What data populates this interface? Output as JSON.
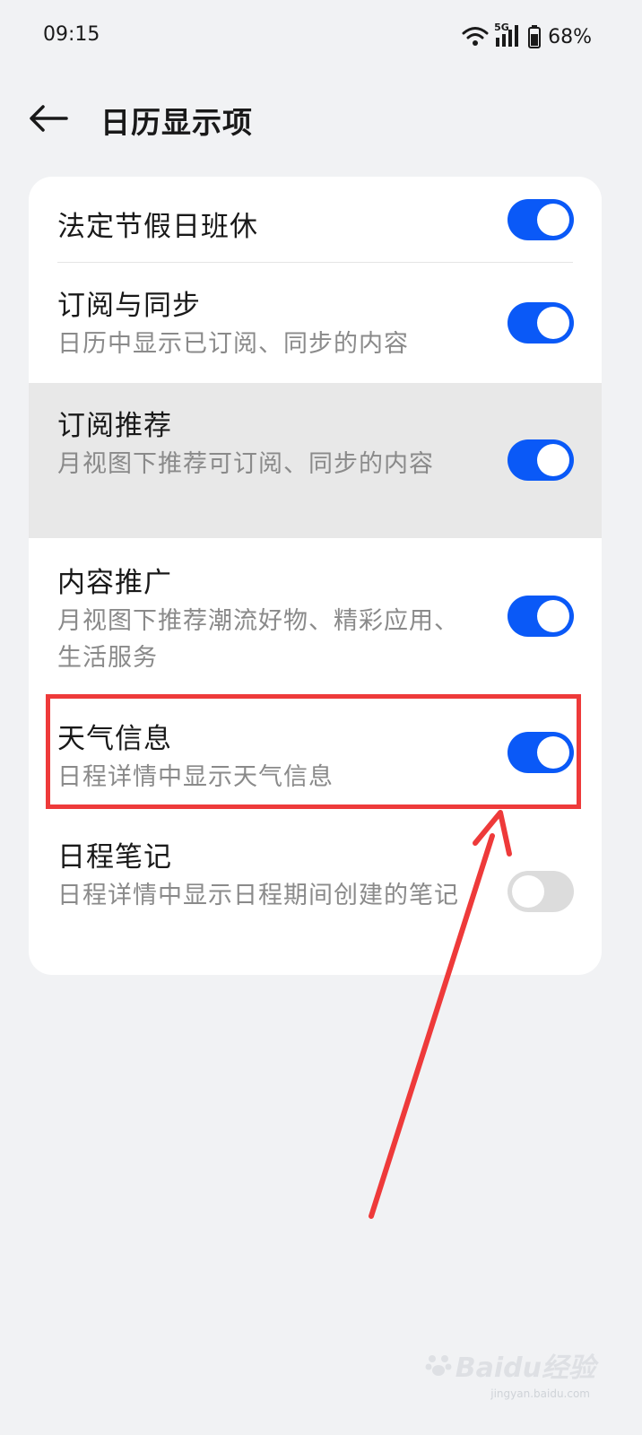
{
  "status_bar": {
    "time": "09:15",
    "network": "5G",
    "battery": "68%",
    "icons": [
      "wifi-icon",
      "signal-icon",
      "battery-icon"
    ]
  },
  "header": {
    "back_icon": "arrow-left-icon",
    "title": "日历显示项"
  },
  "settings": [
    {
      "title": "法定节假日班休",
      "subtitle": "",
      "enabled": true
    },
    {
      "title": "订阅与同步",
      "subtitle": "日历中显示已订阅、同步的内容",
      "enabled": true
    },
    {
      "title": "订阅推荐",
      "subtitle": "月视图下推荐可订阅、同步的内容",
      "enabled": true
    },
    {
      "title": "内容推广",
      "subtitle": "月视图下推荐潮流好物、精彩应用、生活服务",
      "enabled": true
    },
    {
      "title": "天气信息",
      "subtitle": "日程详情中显示天气信息",
      "enabled": true
    },
    {
      "title": "日程笔记",
      "subtitle": "日程详情中显示日程期间创建的笔记",
      "enabled": false
    }
  ],
  "colors": {
    "toggle_on": "#0a59f7",
    "toggle_off": "#dcdcdc",
    "annotation": "#ee3a3a",
    "background": "#f1f2f4"
  },
  "watermark": {
    "text": "Baidu经验",
    "sub": "jingyan.baidu.com"
  }
}
